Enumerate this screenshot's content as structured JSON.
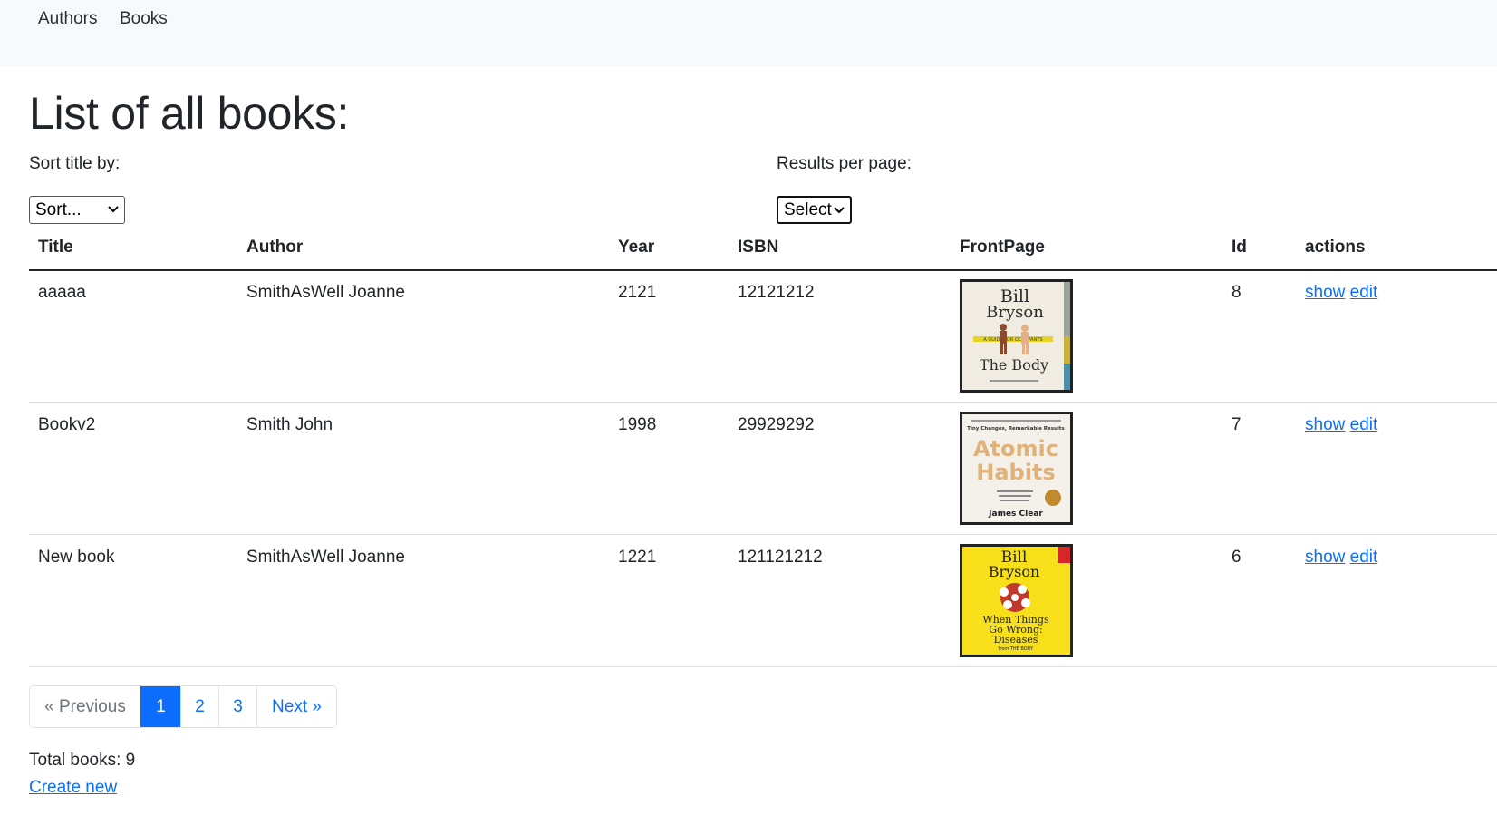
{
  "nav": {
    "authors": "Authors",
    "books": "Books"
  },
  "page_title": "List of all books:",
  "sort": {
    "label": "Sort title by:",
    "selected": "Sort..."
  },
  "per_page": {
    "label": "Results per page:",
    "selected": "Select"
  },
  "table": {
    "headers": [
      "Title",
      "Author",
      "Year",
      "ISBN",
      "FrontPage",
      "Id",
      "actions"
    ],
    "rows": [
      {
        "title": "aaaaa",
        "author": "SmithAsWell Joanne",
        "year": "2121",
        "isbn": "12121212",
        "id": "8",
        "show": "show",
        "edit": "edit",
        "cover": {
          "line1": "Bill",
          "line2": "Bryson",
          "line3": "The Body",
          "tagline": "A GUIDE FOR OCCUPANTS",
          "bg": "#f1ece1"
        }
      },
      {
        "title": "Bookv2",
        "author": "Smith John",
        "year": "1998",
        "isbn": "29929292",
        "id": "7",
        "show": "show",
        "edit": "edit",
        "cover": {
          "top": "Tiny Changes, Remarkable Results",
          "line1": "Atomic",
          "line2": "Habits",
          "author": "James Clear",
          "bg": "#f4f1ea"
        }
      },
      {
        "title": "New book",
        "author": "SmithAsWell Joanne",
        "year": "1221",
        "isbn": "121121212",
        "id": "6",
        "show": "show",
        "edit": "edit",
        "cover": {
          "line1": "Bill",
          "line2": "Bryson",
          "line3": "When Things",
          "line4": "Go Wrong:",
          "line5": "Diseases",
          "small": "from THE BODY",
          "bg": "#f7e01a"
        }
      }
    ]
  },
  "pagination": {
    "previous": "« Previous",
    "pages": [
      "1",
      "2",
      "3"
    ],
    "active": "1",
    "next": "Next »"
  },
  "total": "Total books: 9",
  "create_new": "Create new",
  "colors": {
    "primary": "#0d6efd",
    "navbar_bg": "#f8f9fa",
    "text": "#212529",
    "muted": "#6c757d"
  }
}
